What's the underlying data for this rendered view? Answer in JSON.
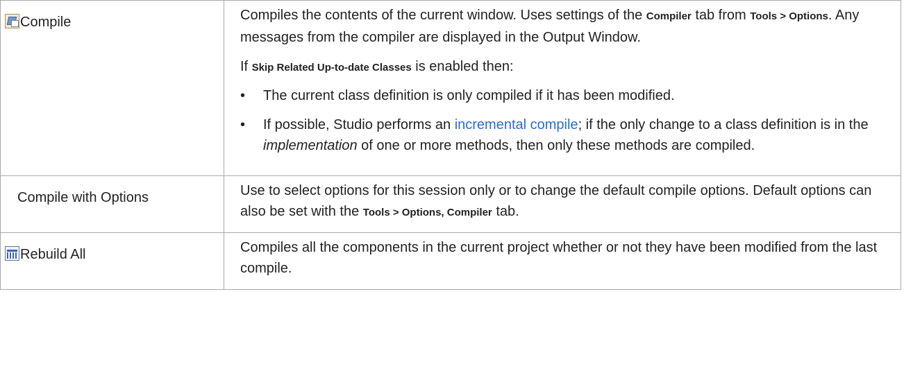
{
  "rows": [
    {
      "command": "Compile",
      "icon": "compile-icon",
      "p1": [
        "Compiles the contents of the current window. Uses settings of the ",
        "Compiler",
        " tab from ",
        "Tools > Options",
        ". Any messages from the compiler are displayed in the Output Window."
      ],
      "p2": [
        "If ",
        "Skip Related Up-to-date Classes",
        " is enabled then:"
      ],
      "bullet_char": "•",
      "bullets": [
        {
          "text": "The current class definition is only compiled if it has been modified."
        },
        {
          "before": "If possible, Studio performs an ",
          "link": "incremental compile",
          "middle": "; if the only change to a class definition is in the ",
          "em": "implementation",
          "after": " of one or more methods, then only these methods are compiled."
        }
      ]
    },
    {
      "command": "Compile with Options",
      "desc": [
        "Use to select options for this session only or to change the default compile options. Default options can also be set with the ",
        "Tools > Options, Compiler",
        " tab."
      ]
    },
    {
      "command": "Rebuild All",
      "icon": "rebuild-icon",
      "desc": [
        "Compiles all the components in the current project whether or not they have been modified from the last compile."
      ]
    }
  ]
}
